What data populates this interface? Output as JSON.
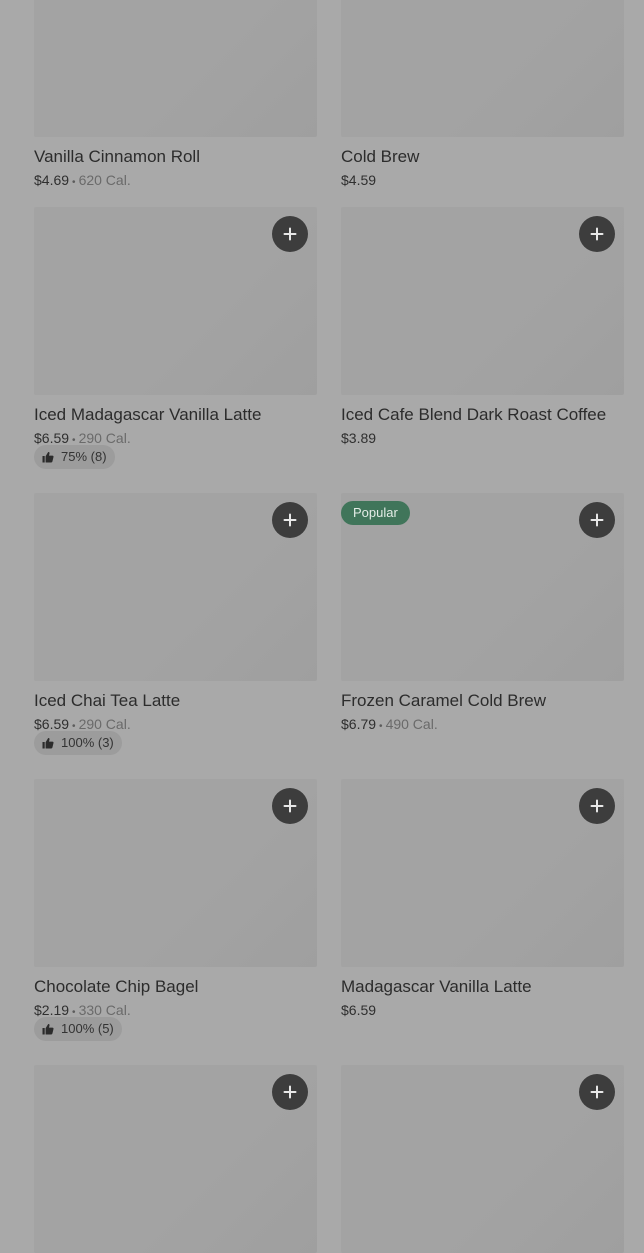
{
  "items": [
    {
      "name": "Vanilla Cinnamon Roll",
      "price": "$4.69",
      "calories": "620 Cal.",
      "rating": null,
      "badge": null,
      "show_add": false
    },
    {
      "name": "Cold Brew",
      "price": "$4.59",
      "calories": null,
      "rating": null,
      "badge": null,
      "show_add": false
    },
    {
      "name": "Iced Madagascar Vanilla Latte",
      "price": "$6.59",
      "calories": "290 Cal.",
      "rating": "75% (8)",
      "badge": null,
      "show_add": true
    },
    {
      "name": "Iced Cafe Blend Dark Roast Coffee",
      "price": "$3.89",
      "calories": null,
      "rating": null,
      "badge": null,
      "show_add": true
    },
    {
      "name": "Iced Chai Tea Latte",
      "price": "$6.59",
      "calories": "290 Cal.",
      "rating": "100% (3)",
      "badge": null,
      "show_add": true
    },
    {
      "name": "Frozen Caramel Cold Brew",
      "price": "$6.79",
      "calories": "490 Cal.",
      "rating": null,
      "badge": "Popular",
      "show_add": true
    },
    {
      "name": "Chocolate Chip Bagel",
      "price": "$2.19",
      "calories": "330 Cal.",
      "rating": "100% (5)",
      "badge": null,
      "show_add": true
    },
    {
      "name": "Madagascar Vanilla Latte",
      "price": "$6.59",
      "calories": null,
      "rating": null,
      "badge": null,
      "show_add": true
    },
    {
      "name": null,
      "price": null,
      "calories": null,
      "rating": null,
      "badge": null,
      "show_add": true
    },
    {
      "name": null,
      "price": null,
      "calories": null,
      "rating": null,
      "badge": null,
      "show_add": true
    }
  ],
  "separator": "•",
  "icons": {
    "add": "plus-icon",
    "rating": "thumbs-up-icon"
  },
  "colors": {
    "overlay": "#a9a9a9",
    "popular_badge": "#40755a",
    "add_button": "#3d3d3d"
  }
}
